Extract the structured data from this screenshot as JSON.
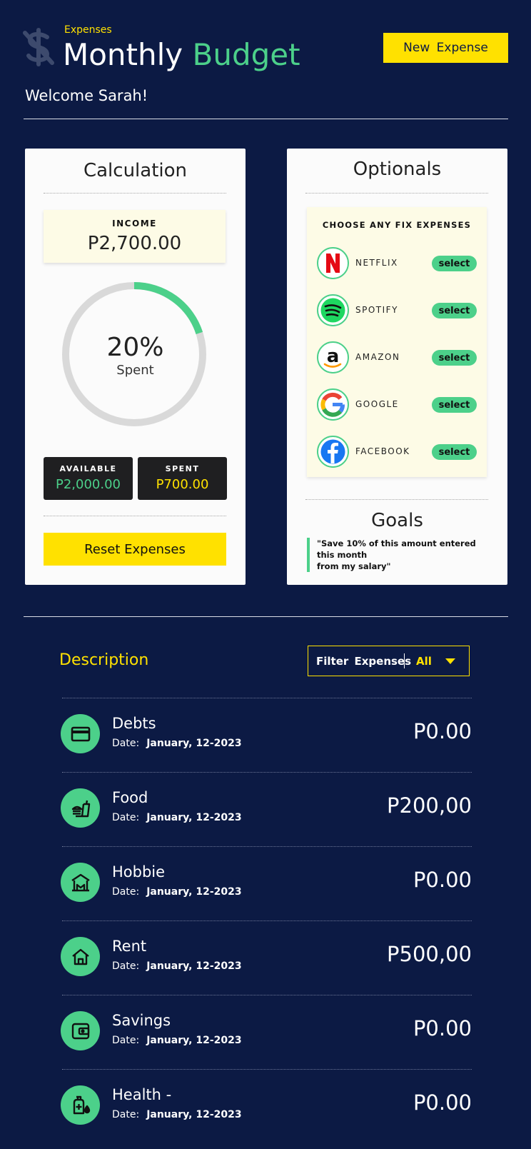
{
  "header": {
    "subtitle": "Expenses",
    "title_part1": "Monthly",
    "title_part2": "Budget",
    "new_expense_label": "New  Expense",
    "welcome": "Welcome Sarah!"
  },
  "calculation": {
    "title": "Calculation",
    "income_label": "INCOME",
    "income_value": "P2,700.00",
    "spent_percent_text": "20%",
    "spent_percent": 0.2,
    "spent_caption": "Spent",
    "available_label": "AVAILABLE",
    "available_value": "P2,000.00",
    "spent_label": "SPENT",
    "spent_value": "P700.00",
    "reset_label": "Reset Expenses"
  },
  "optionals": {
    "title": "Optionals",
    "fix_title": "CHOOSE ANY FIX EXPENSES",
    "select_label": "select",
    "services": [
      {
        "name": "NETFLIX",
        "icon": "netflix-logo"
      },
      {
        "name": "SPOTIFY",
        "icon": "spotify-logo"
      },
      {
        "name": "AMAZON",
        "icon": "amazon-logo"
      },
      {
        "name": "GOOGLE",
        "icon": "google-logo"
      },
      {
        "name": "FACEBOOK",
        "icon": "facebook-logo"
      }
    ],
    "goals_title": "Goals",
    "goal_line1": "\"Save 10% of this amount entered this month",
    "goal_line2": "from my salary\""
  },
  "expenses": {
    "description_label": "Description",
    "filter_label": "Filter  Expenses",
    "filter_value": "All",
    "date_label": "Date:",
    "items": [
      {
        "name": "Debts",
        "date": "January, 12-2023",
        "amount": "P0.00",
        "icon": "credit-card-icon"
      },
      {
        "name": "Food",
        "date": "January, 12-2023",
        "amount": "P200,00",
        "icon": "food-icon"
      },
      {
        "name": "Hobbie",
        "date": "January, 12-2023",
        "amount": "P0.00",
        "icon": "hobbie-icon"
      },
      {
        "name": "Rent",
        "date": "January, 12-2023",
        "amount": "P500,00",
        "icon": "home-icon"
      },
      {
        "name": "Savings",
        "date": "January, 12-2023",
        "amount": "P0.00",
        "icon": "wallet-icon"
      },
      {
        "name": "Health -",
        "date": "January, 12-2023",
        "amount": "P0.00",
        "icon": "health-icon"
      }
    ]
  },
  "colors": {
    "background": "#0c1a44",
    "accent_yellow": "#ffe100",
    "accent_green": "#4cd08a",
    "card": "#fbfbfb",
    "cream": "#fdfbe6"
  }
}
